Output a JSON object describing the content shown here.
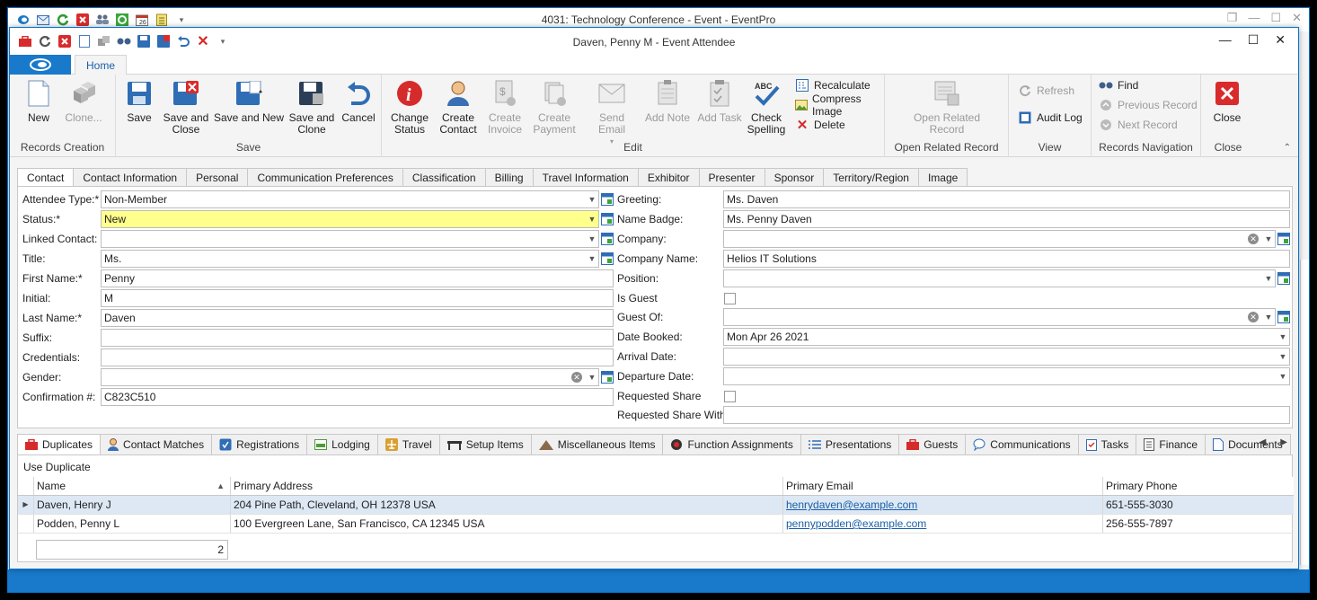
{
  "outer_window": {
    "title": "4031: Technology Conference - Event - EventPro",
    "qat_icons": [
      "logo-icon",
      "mail-icon",
      "refresh-icon",
      "close-red-icon",
      "users-icon",
      "gear-green-icon",
      "calendar-icon",
      "notepad-icon",
      "customize-icon"
    ]
  },
  "window": {
    "title": "Daven, Penny M - Event Attendee"
  },
  "ribbon": {
    "tab_home": "Home",
    "groups": {
      "records_creation": "Records Creation",
      "save": "Save",
      "edit": "Edit",
      "open_related": "Open Related Record",
      "view": "View",
      "records_navigation": "Records Navigation",
      "close": "Close"
    },
    "buttons": {
      "new": "New",
      "clone": "Clone...",
      "save": "Save",
      "save_and_close_1": "Save and",
      "save_and_close_2": "Close",
      "save_and_new": "Save and New",
      "save_and_clone_1": "Save and",
      "save_and_clone_2": "Clone",
      "cancel": "Cancel",
      "change_status_1": "Change",
      "change_status_2": "Status",
      "create_contact_1": "Create",
      "create_contact_2": "Contact",
      "create_invoice_1": "Create",
      "create_invoice_2": "Invoice",
      "create_payment_1": "Create",
      "create_payment_2": "Payment",
      "send_email": "Send Email",
      "add_note": "Add Note",
      "add_task": "Add Task",
      "check_spelling_1": "Check",
      "check_spelling_2": "Spelling",
      "recalculate": "Recalculate",
      "compress_image": "Compress Image",
      "delete": "Delete",
      "open_related_1": "Open Related",
      "open_related_2": "Record",
      "refresh": "Refresh",
      "audit_log": "Audit Log",
      "find": "Find",
      "previous_record": "Previous Record",
      "next_record": "Next Record",
      "close": "Close"
    }
  },
  "form_tabs": [
    "Contact",
    "Contact Information",
    "Personal",
    "Communication Preferences",
    "Classification",
    "Billing",
    "Travel Information",
    "Exhibitor",
    "Presenter",
    "Sponsor",
    "Territory/Region",
    "Image"
  ],
  "form": {
    "left": {
      "attendee_type_label": "Attendee Type:*",
      "attendee_type": "Non-Member",
      "status_label": "Status:*",
      "status": "New",
      "linked_contact_label": "Linked Contact:",
      "linked_contact": "",
      "title_label": "Title:",
      "title": "Ms.",
      "first_name_label": "First Name:*",
      "first_name": "Penny",
      "initial_label": "Initial:",
      "initial": "M",
      "last_name_label": "Last Name:*",
      "last_name": "Daven",
      "suffix_label": "Suffix:",
      "suffix": "",
      "credentials_label": "Credentials:",
      "credentials": "",
      "gender_label": "Gender:",
      "gender": "",
      "confirmation_label": "Confirmation #:",
      "confirmation": "C823C510"
    },
    "right": {
      "greeting_label": "Greeting:",
      "greeting": "Ms. Daven",
      "name_badge_label": "Name Badge:",
      "name_badge": "Ms. Penny Daven",
      "company_label": "Company:",
      "company": "",
      "company_name_label": "Company Name:",
      "company_name": "Helios IT Solutions",
      "position_label": "Position:",
      "position": "",
      "is_guest_label": "Is Guest",
      "guest_of_label": "Guest Of:",
      "guest_of": "",
      "date_booked_label": "Date Booked:",
      "date_booked": "Mon Apr 26 2021",
      "arrival_date_label": "Arrival Date:",
      "arrival_date": "",
      "departure_date_label": "Departure Date:",
      "departure_date": "",
      "requested_share_label": "Requested Share",
      "requested_share_with_label": "Requested Share With:",
      "requested_share_with": ""
    }
  },
  "sub_tabs": [
    {
      "label": "Duplicates",
      "icon": "briefcase-icon"
    },
    {
      "label": "Contact Matches",
      "icon": "person-icon"
    },
    {
      "label": "Registrations",
      "icon": "registration-icon"
    },
    {
      "label": "Lodging",
      "icon": "lodging-icon"
    },
    {
      "label": "Travel",
      "icon": "plane-icon"
    },
    {
      "label": "Setup Items",
      "icon": "table-icon"
    },
    {
      "label": "Miscellaneous Items",
      "icon": "pile-icon"
    },
    {
      "label": "Function Assignments",
      "icon": "function-icon"
    },
    {
      "label": "Presentations",
      "icon": "list-icon"
    },
    {
      "label": "Guests",
      "icon": "briefcase-icon"
    },
    {
      "label": "Communications",
      "icon": "speech-icon"
    },
    {
      "label": "Tasks",
      "icon": "clipboard-icon"
    },
    {
      "label": "Finance",
      "icon": "calculator-icon"
    },
    {
      "label": "Documents",
      "icon": "document-icon"
    }
  ],
  "duplicates": {
    "use_duplicate": "Use Duplicate",
    "columns": [
      "Name",
      "Primary Address",
      "Primary Email",
      "Primary Phone"
    ],
    "rows": [
      {
        "name": "Daven, Henry J",
        "address": "204 Pine Path, Cleveland, OH 12378 USA",
        "email": "henrydaven@example.com",
        "phone": "651-555-3030"
      },
      {
        "name": "Podden, Penny L",
        "address": "100 Evergreen Lane, San Francisco, CA 12345 USA",
        "email": "pennypodden@example.com",
        "phone": "256-555-7897"
      }
    ],
    "count": "2"
  },
  "colors": {
    "accent": "#1979ca",
    "required_highlight": "#ffff8c",
    "selected_row": "#dde8f4"
  }
}
